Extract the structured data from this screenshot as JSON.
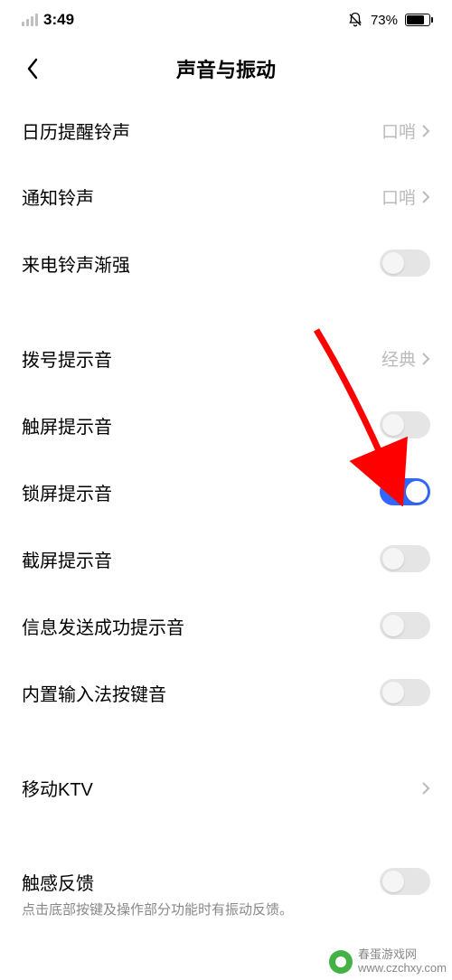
{
  "status": {
    "time": "3:49",
    "battery_pct": "73%"
  },
  "nav": {
    "title": "声音与振动"
  },
  "group1": [
    {
      "label": "日历提醒铃声",
      "value": "口哨",
      "type": "link"
    },
    {
      "label": "通知铃声",
      "value": "口哨",
      "type": "link"
    },
    {
      "label": "来电铃声渐强",
      "type": "toggle",
      "on": false
    }
  ],
  "group2": [
    {
      "label": "拨号提示音",
      "value": "经典",
      "type": "link"
    },
    {
      "label": "触屏提示音",
      "type": "toggle",
      "on": false
    },
    {
      "label": "锁屏提示音",
      "type": "toggle",
      "on": true
    },
    {
      "label": "截屏提示音",
      "type": "toggle",
      "on": false
    },
    {
      "label": "信息发送成功提示音",
      "type": "toggle",
      "on": false
    },
    {
      "label": "内置输入法按键音",
      "type": "toggle",
      "on": false
    }
  ],
  "group3": [
    {
      "label": "移动KTV",
      "type": "link"
    }
  ],
  "group4": [
    {
      "label": "触感反馈",
      "type": "toggle",
      "on": false,
      "subtitle": "点击底部按键及操作部分功能时有振动反馈。"
    }
  ],
  "watermark": {
    "line1": "春蛋游戏网",
    "line2": "www.czchxy.com"
  }
}
